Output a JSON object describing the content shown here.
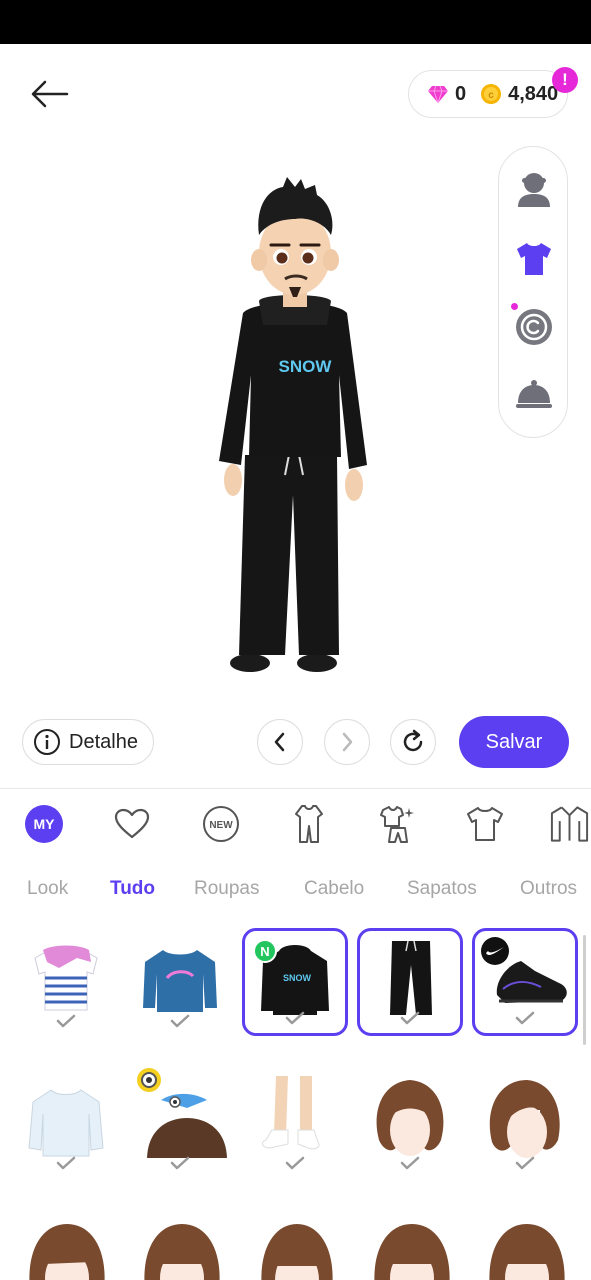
{
  "header": {
    "gems": "0",
    "coins": "4,840",
    "notification_badge": "!"
  },
  "avatar": {
    "hoodie_text": "SNOW"
  },
  "actions": {
    "detail_label": "Detalhe",
    "save_label": "Salvar"
  },
  "categories": [
    "my",
    "favorites",
    "new",
    "outfit",
    "set",
    "top",
    "jacket"
  ],
  "category_my_label": "MY",
  "category_new_label": "NEW",
  "subtabs": [
    {
      "label": "Look",
      "active": false
    },
    {
      "label": "Tudo",
      "active": true
    },
    {
      "label": "Roupas",
      "active": false
    },
    {
      "label": "Cabelo",
      "active": false
    },
    {
      "label": "Sapatos",
      "active": false
    },
    {
      "label": "Outros",
      "active": false
    }
  ],
  "items_row1": [
    {
      "name": "striped-shirt-with-scarf",
      "selected": false
    },
    {
      "name": "blue-sweatshirt",
      "selected": false
    },
    {
      "name": "snow-hoodie",
      "selected": true,
      "badge": "N",
      "text": "SNOW"
    },
    {
      "name": "black-pants",
      "selected": true
    },
    {
      "name": "black-sneakers",
      "selected": true,
      "badge": "brand"
    }
  ],
  "items_row2": [
    {
      "name": "white-long-sleeve-top",
      "selected": false
    },
    {
      "name": "minion-bird-hat",
      "selected": false
    },
    {
      "name": "white-socks",
      "selected": false
    },
    {
      "name": "wavy-bob-hair",
      "selected": false
    },
    {
      "name": "side-part-bob-hair",
      "selected": false
    }
  ],
  "colors": {
    "accent": "#5b3ff0",
    "notification": "#e629d8",
    "new_badge": "#22c55e"
  }
}
